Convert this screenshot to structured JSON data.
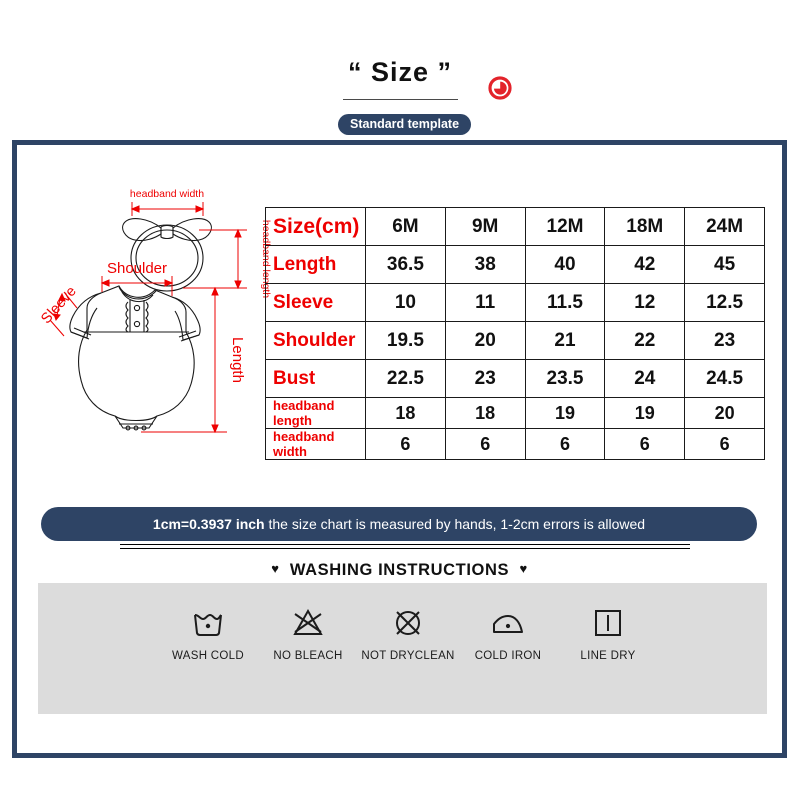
{
  "header": {
    "title": "“ Size ”",
    "pill_label": "Standard template",
    "badge_icon": "red-circle-leaf-badge"
  },
  "diagram": {
    "labels": {
      "headband_width": "headband width",
      "headband_length": "headband length",
      "shoulder": "Shoulder",
      "sleeve": "Sleeve",
      "length": "Length"
    },
    "garment_icon": "baby-romper-outline",
    "headband_icon": "headband-bow-outline"
  },
  "chart_data": {
    "type": "table",
    "title": "Size(cm)",
    "categories": [
      "6M",
      "9M",
      "12M",
      "18M",
      "24M"
    ],
    "series": [
      {
        "name": "Length",
        "values": [
          "36.5",
          "38",
          "40",
          "42",
          "45"
        ]
      },
      {
        "name": "Sleeve",
        "values": [
          "10",
          "11",
          "11.5",
          "12",
          "12.5"
        ]
      },
      {
        "name": "Shoulder",
        "values": [
          "19.5",
          "20",
          "21",
          "22",
          "23"
        ]
      },
      {
        "name": "Bust",
        "values": [
          "22.5",
          "23",
          "23.5",
          "24",
          "24.5"
        ]
      },
      {
        "name": "headband length",
        "values": [
          "18",
          "18",
          "19",
          "19",
          "20"
        ]
      },
      {
        "name": "headband width",
        "values": [
          "6",
          "6",
          "6",
          "6",
          "6"
        ]
      }
    ]
  },
  "table": {
    "corner_label": "Size(cm)",
    "columns": [
      "6M",
      "9M",
      "12M",
      "18M",
      "24M"
    ],
    "rows": [
      {
        "label": "Length",
        "small": false,
        "values": [
          "36.5",
          "38",
          "40",
          "42",
          "45"
        ]
      },
      {
        "label": "Sleeve",
        "small": false,
        "values": [
          "10",
          "11",
          "11.5",
          "12",
          "12.5"
        ]
      },
      {
        "label": "Shoulder",
        "small": false,
        "values": [
          "19.5",
          "20",
          "21",
          "22",
          "23"
        ]
      },
      {
        "label": "Bust",
        "small": false,
        "values": [
          "22.5",
          "23",
          "23.5",
          "24",
          "24.5"
        ]
      },
      {
        "label": "headband length",
        "small": true,
        "values": [
          "18",
          "18",
          "19",
          "19",
          "20"
        ]
      },
      {
        "label": "headband width",
        "small": true,
        "values": [
          "6",
          "6",
          "6",
          "6",
          "6"
        ]
      }
    ]
  },
  "banner": {
    "conversion": "1cm=0.3937 inch",
    "note": " the size chart is measured by hands, 1-2cm errors is allowed"
  },
  "washing": {
    "heading": "WASHING INSTRUCTIONS",
    "heart": "♥",
    "items": [
      {
        "label": "WASH COLD",
        "icon": "wash-tub-one-dot-icon"
      },
      {
        "label": "NO BLEACH",
        "icon": "crossed-triangle-icon"
      },
      {
        "label": "NOT DRYCLEAN",
        "icon": "crossed-circle-icon"
      },
      {
        "label": "COLD IRON",
        "icon": "iron-one-dot-icon"
      },
      {
        "label": "LINE DRY",
        "icon": "square-vertical-line-icon"
      }
    ]
  },
  "colors": {
    "navy": "#2e4465",
    "red": "#ee0000",
    "panel_gray": "#dcdcdc",
    "ink": "#111111"
  }
}
